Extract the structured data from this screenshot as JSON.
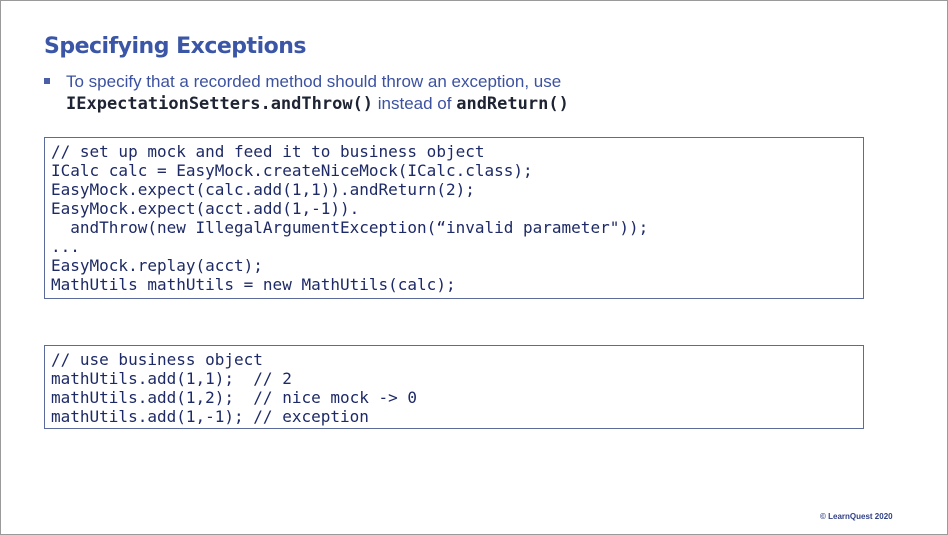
{
  "slide": {
    "title": "Specifying Exceptions",
    "bullet": {
      "text_before": "To specify that a recorded method should throw an exception, use",
      "code1": "IExpectationSetters.andThrow()",
      "text_middle": " instead of ",
      "code2": "andReturn()"
    },
    "code_block_1": [
      "// set up mock and feed it to business object",
      "ICalc calc = EasyMock.createNiceMock(ICalc.class);",
      "EasyMock.expect(calc.add(1,1)).andReturn(2);",
      "EasyMock.expect(acct.add(1,-1)).",
      "  andThrow(new IllegalArgumentException(“invalid parameter\"));",
      "...",
      "EasyMock.replay(acct);",
      "MathUtils mathUtils = new MathUtils(calc);"
    ],
    "code_block_2": [
      "// use business object",
      "mathUtils.add(1,1);  // 2",
      "mathUtils.add(1,2);  // nice mock -> 0",
      "mathUtils.add(1,-1); // exception"
    ],
    "copyright": "© LearnQuest 2020"
  },
  "colors": {
    "title": "#3b56a6",
    "code": "#1d2a66",
    "box_border": "#5d6b9c"
  }
}
